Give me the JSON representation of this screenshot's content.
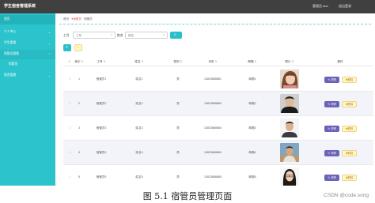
{
  "app": {
    "title": "学生宿舍管理系统",
    "user_label": "管理员 abo",
    "logout_label": "退出登录"
  },
  "sidebar": {
    "items": [
      {
        "label": "首页",
        "has_chevron": false
      },
      {
        "label": "个人中心",
        "has_chevron": true
      },
      {
        "label": "学生管理",
        "has_chevron": true
      },
      {
        "label": "宿管员管理",
        "has_chevron": true
      },
      {
        "label": "宿管员",
        "has_chevron": false
      },
      {
        "label": "宿舍管理",
        "has_chevron": true
      }
    ]
  },
  "breadcrumb": [
    "首页",
    "宿管员",
    "宿管员"
  ],
  "filters": {
    "id_label": "工号",
    "id_placeholder": "工号",
    "name_label": "姓名",
    "name_placeholder": "姓名",
    "query_icon": "search-icon"
  },
  "actions": {
    "add_icon": "plus-icon",
    "delete_icon": "minus-icon"
  },
  "table": {
    "columns": [
      "",
      "索引",
      "工号",
      "姓名",
      "性别",
      "手机",
      "邮箱",
      "照片",
      "操作"
    ],
    "rows": [
      {
        "index": "1",
        "id": "宿管员1",
        "name": "姓名1",
        "gender": "男",
        "phone": "13823888881",
        "email": "邮箱1",
        "photo": "woman-brown-hair"
      },
      {
        "index": "2",
        "id": "宿管员2",
        "name": "姓名2",
        "gender": "男",
        "phone": "13823888882",
        "email": "邮箱2",
        "photo": "man-dark-shirt"
      },
      {
        "index": "3",
        "id": "宿管员3",
        "name": "姓名3",
        "gender": "男",
        "phone": "13823888883",
        "email": "邮箱3",
        "photo": "man-white-background"
      },
      {
        "index": "4",
        "id": "宿管员4",
        "name": "姓名4",
        "gender": "男",
        "phone": "13823888884",
        "email": "邮箱4",
        "photo": "man-outdoor"
      },
      {
        "index": "5",
        "id": "宿管员5",
        "name": "姓名5",
        "gender": "男",
        "phone": "13823888885",
        "email": "邮箱5",
        "photo": "woman-glasses"
      }
    ],
    "edit_label": "详情",
    "delete_label": "删除"
  },
  "caption": "图 5.1  宿管员管理页面",
  "watermark": "CSDN @code.song",
  "colors": {
    "sidebar": "#2bc4cc",
    "topbar": "#404040",
    "accent": "#2bbfcb",
    "edit_button": "#6a63b8",
    "delete_button": "#fff6c2",
    "breadcrumb_active": "#e05a5a"
  }
}
